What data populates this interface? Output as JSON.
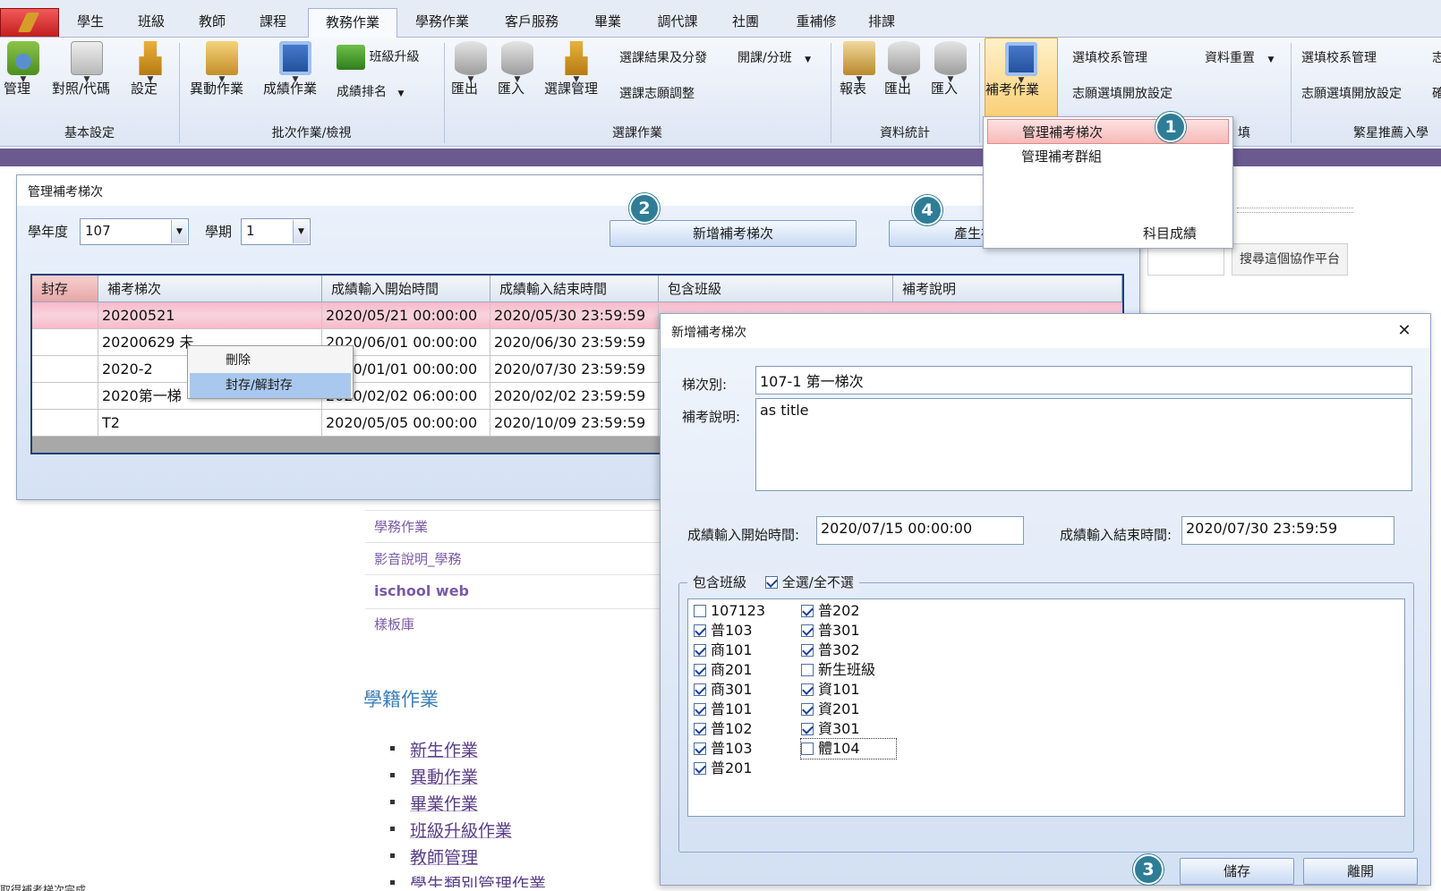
{
  "ribbon": {
    "tabs": [
      {
        "label": "學生"
      },
      {
        "label": "班級"
      },
      {
        "label": "教師"
      },
      {
        "label": "課程"
      },
      {
        "label": "教務作業"
      },
      {
        "label": "學務作業"
      },
      {
        "label": "客戶服務"
      },
      {
        "label": "畢業"
      },
      {
        "label": "調代課"
      },
      {
        "label": "社團"
      },
      {
        "label": "重補修"
      },
      {
        "label": "排課"
      }
    ],
    "active_tab": "教務作業",
    "groups": {
      "basic": {
        "label": "基本設定",
        "manage": "管理",
        "mapping": "對照/代碼",
        "settings": "設定"
      },
      "batch": {
        "label": "批次作業/檢視",
        "change": "異動作業",
        "score": "成績作業",
        "class_upgrade": "班級升級",
        "score_rank": "成績排名"
      },
      "course": {
        "label": "選課作業",
        "export": "匯出",
        "import": "匯入",
        "course_manage": "選課管理",
        "result_assign": "選課結果及分發",
        "open_split": "開課/分班",
        "wish_adjust": "選課志願調整"
      },
      "stats": {
        "label": "資料統計",
        "report": "報表",
        "export": "匯出",
        "import": "匯入"
      },
      "makeup": {
        "button": "補考作業",
        "dept_manage": "選填校系管理",
        "data_reset": "資料重置",
        "wish_open": "志願選填開放設定",
        "partial_label": "填"
      },
      "star": {
        "dept_manage": "選填校系管理",
        "wish_open": "志願選填開放設定",
        "label": "繁星推薦入學",
        "cut_1": "志",
        "cut_2": "確"
      }
    }
  },
  "dropdown": {
    "items": [
      "管理補考梯次",
      "管理補考群組"
    ],
    "partial_item": "科目成績"
  },
  "background_page": {
    "links": [
      "學務作業",
      "影音說明_學務",
      "ischool web",
      "樣板庫"
    ],
    "heading": "學籍作業",
    "list": [
      "新生作業",
      "異動作業",
      "畢業作業",
      "班級升級作業",
      "教師管理",
      "學生類別管理作業"
    ],
    "search_button": "搜尋這個協作平台",
    "status": "取得補考梯次完成"
  },
  "win1": {
    "title": "管理補考梯次",
    "school_year_label": "學年度",
    "school_year": "107",
    "semester_label": "學期",
    "semester": "1",
    "add_button": "新增補考梯次",
    "group_button": "產生補考群組",
    "columns": [
      "封存",
      "補考梯次",
      "成績輸入開始時間",
      "成績輸入結束時間",
      "包含班級",
      "補考說明"
    ],
    "rows": [
      {
        "archived": "",
        "name": "20200521",
        "start": "2020/05/21 00:00:00",
        "end": "2020/05/30 23:59:59"
      },
      {
        "archived": "",
        "name": "20200629 未",
        "start": "2020/06/01 00:00:00",
        "end": "2020/06/30 23:59:59"
      },
      {
        "archived": "",
        "name": "2020-2",
        "start": "2020/01/01 00:00:00",
        "end": "2020/07/30 23:59:59"
      },
      {
        "archived": "",
        "name": "2020第一梯",
        "start": "2020/02/02 06:00:00",
        "end": "2020/02/02 23:59:59"
      },
      {
        "archived": "",
        "name": "T2",
        "start": "2020/05/05 00:00:00",
        "end": "2020/10/09 23:59:59"
      }
    ],
    "context_menu": [
      "刪除",
      "封存/解封存"
    ]
  },
  "win2": {
    "title": "新增補考梯次",
    "round_label": "梯次別:",
    "round_value": "107-1 第一梯次",
    "desc_label": "補考說明:",
    "desc_value": "as title",
    "start_label": "成績輸入開始時間:",
    "start_value": "2020/07/15 00:00:00",
    "end_label": "成績輸入結束時間:",
    "end_value": "2020/07/30 23:59:59",
    "classes_label": "包含班級",
    "select_all": "全選/全不選",
    "classes": [
      {
        "name": "107123",
        "checked": false
      },
      {
        "name": "普103",
        "checked": true
      },
      {
        "name": "商101",
        "checked": true
      },
      {
        "name": "商201",
        "checked": true
      },
      {
        "name": "商301",
        "checked": true
      },
      {
        "name": "普101",
        "checked": true
      },
      {
        "name": "普102",
        "checked": true
      },
      {
        "name": "普103",
        "checked": true
      },
      {
        "name": "普201",
        "checked": true
      },
      {
        "name": "普202",
        "checked": true
      },
      {
        "name": "普301",
        "checked": true
      },
      {
        "name": "普302",
        "checked": true
      },
      {
        "name": "新生班級",
        "checked": false
      },
      {
        "name": "資101",
        "checked": true
      },
      {
        "name": "資201",
        "checked": true
      },
      {
        "name": "資301",
        "checked": true
      },
      {
        "name": "體104",
        "checked": false
      }
    ],
    "save_button": "儲存",
    "close_button": "離開"
  },
  "badges": [
    "1",
    "2",
    "3",
    "4"
  ]
}
